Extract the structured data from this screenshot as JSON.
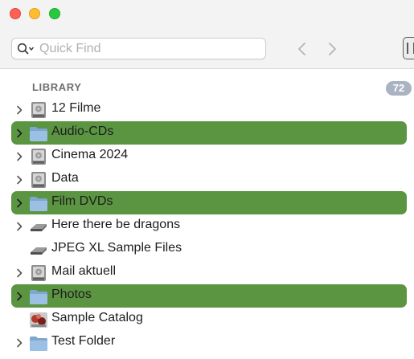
{
  "search": {
    "placeholder": "Quick Find"
  },
  "sidebar": {
    "section_title": "LIBRARY",
    "count": "72",
    "highlight_color": "#5b9541",
    "items": [
      {
        "label": "12 Filme",
        "icon": "disk-image-icon",
        "expandable": true,
        "highlighted": false
      },
      {
        "label": "Audio-CDs",
        "icon": "folder-icon",
        "expandable": true,
        "highlighted": true
      },
      {
        "label": "Cinema 2024",
        "icon": "disk-image-icon",
        "expandable": true,
        "highlighted": false
      },
      {
        "label": "Data",
        "icon": "disk-image-icon",
        "expandable": true,
        "highlighted": false
      },
      {
        "label": "Film DVDs",
        "icon": "folder-icon",
        "expandable": true,
        "highlighted": true
      },
      {
        "label": "Here there be dragons",
        "icon": "drive-icon",
        "expandable": true,
        "highlighted": false
      },
      {
        "label": "JPEG XL Sample Files",
        "icon": "drive-icon",
        "expandable": false,
        "highlighted": false
      },
      {
        "label": "Mail aktuell",
        "icon": "disk-image-icon",
        "expandable": true,
        "highlighted": false
      },
      {
        "label": "Photos",
        "icon": "folder-icon",
        "expandable": true,
        "highlighted": true
      },
      {
        "label": "Sample Catalog",
        "icon": "catalog-icon",
        "expandable": false,
        "highlighted": false
      },
      {
        "label": "Test Folder",
        "icon": "folder-icon",
        "expandable": true,
        "highlighted": false
      }
    ]
  }
}
